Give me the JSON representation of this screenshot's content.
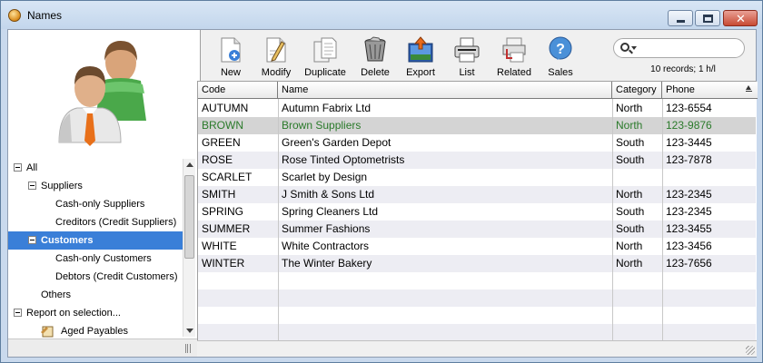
{
  "window": {
    "title": "Names"
  },
  "tree": {
    "items": [
      {
        "label": "All",
        "level": 0,
        "expander": true
      },
      {
        "label": "Suppliers",
        "level": 1,
        "expander": true
      },
      {
        "label": "Cash-only Suppliers",
        "level": 2,
        "expander": false
      },
      {
        "label": "Creditors (Credit Suppliers)",
        "level": 2,
        "expander": false
      },
      {
        "label": "Customers",
        "level": 1,
        "expander": true,
        "selected": true
      },
      {
        "label": "Cash-only Customers",
        "level": 2,
        "expander": false
      },
      {
        "label": "Debtors (Credit Customers)",
        "level": 2,
        "expander": false
      },
      {
        "label": "Others",
        "level": 1,
        "expander": false
      },
      {
        "label": "Report on selection...",
        "level": 0,
        "expander": true
      },
      {
        "label": "Aged Payables",
        "level": 1,
        "expander": false,
        "icon": true
      }
    ]
  },
  "toolbar": {
    "buttons": [
      {
        "label": "New",
        "icon": "new-document-icon"
      },
      {
        "label": "Modify",
        "icon": "pencil-document-icon"
      },
      {
        "label": "Duplicate",
        "icon": "duplicate-documents-icon"
      },
      {
        "label": "Delete",
        "icon": "trash-bin-icon"
      },
      {
        "label": "Export",
        "icon": "export-icon"
      },
      {
        "label": "List",
        "icon": "printer-icon"
      },
      {
        "label": "Related",
        "icon": "related-icon"
      },
      {
        "label": "Sales",
        "icon": "help-bubble-icon"
      }
    ],
    "records_text": "10 records; 1 h/l"
  },
  "table": {
    "columns": [
      "Code",
      "Name",
      "Category",
      "Phone"
    ],
    "rows": [
      {
        "code": "AUTUMN",
        "name": "Autumn Fabrix Ltd",
        "category": "North",
        "phone": "123-6554"
      },
      {
        "code": "BROWN",
        "name": "Brown Suppliers",
        "category": "North",
        "phone": "123-9876",
        "selected": true
      },
      {
        "code": "GREEN",
        "name": "Green's Garden Depot",
        "category": "South",
        "phone": "123-3445"
      },
      {
        "code": "ROSE",
        "name": "Rose Tinted Optometrists",
        "category": "South",
        "phone": "123-7878"
      },
      {
        "code": "SCARLET",
        "name": "Scarlet by Design",
        "category": "",
        "phone": ""
      },
      {
        "code": "SMITH",
        "name": "J Smith & Sons Ltd",
        "category": "North",
        "phone": "123-2345"
      },
      {
        "code": "SPRING",
        "name": "Spring Cleaners Ltd",
        "category": "South",
        "phone": "123-2345"
      },
      {
        "code": "SUMMER",
        "name": "Summer Fashions",
        "category": "South",
        "phone": "123-3455"
      },
      {
        "code": "WHITE",
        "name": "White Contractors",
        "category": "North",
        "phone": "123-3456"
      },
      {
        "code": "WINTER",
        "name": "The Winter Bakery",
        "category": "North",
        "phone": "123-7656"
      }
    ]
  },
  "colors": {
    "selection": "#3a7fd8",
    "selected_row_text": "#2a7a2a",
    "alt_row": "#ededf3"
  }
}
